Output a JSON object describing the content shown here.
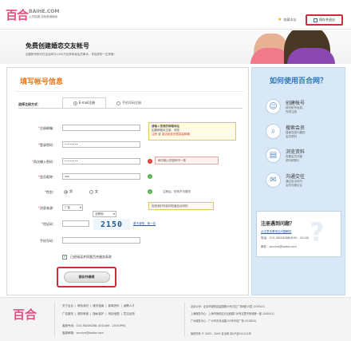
{
  "header": {
    "logo_text": "百合",
    "logo_domain": "BAIHE.COM",
    "logo_slogan": "心灵相通 成就美满姻缘",
    "favorite_label": "收藏本站",
    "save_exit_label": "保存并退出"
  },
  "banner": {
    "title": "免费创建婚恋交友帐号",
    "subtitle": "创建帐号即可在百合网与1500万优秀单身会员牵手，寻找您的一生挚爱!"
  },
  "form": {
    "title": "填写帐号信息",
    "method_label": "选择注册方式：",
    "tabs": [
      {
        "label": "E-mail注册",
        "selected": true
      },
      {
        "label": "手机号码注册",
        "selected": false
      }
    ],
    "fields": {
      "email_label": "注册邮箱：",
      "email_value": "",
      "email_tip_line1": "请输入常用的邮箱地址",
      "email_tip_line2": "如果邮箱未注册，请您",
      "email_tip_link1": "注册",
      "email_tip_or": "或",
      "email_tip_link2": "激活免费无限容量邮箱",
      "password_label": "登录密码：",
      "password_value": "••••••••",
      "confirm_label": "再次输入密码：",
      "confirm_value": "••••••••",
      "confirm_error": "两次输入的密码不一致",
      "nickname_label": "会员昵称：",
      "nickname_value": "san",
      "gender_label": "性别：",
      "gender_male": "男",
      "gender_female": "女",
      "gender_hint": "注册后，性别不可更改",
      "source_label": "消息来源：",
      "source_select1": "广告",
      "source_select2": "互联网",
      "source_hint": "告知我们你如何知道百合网的",
      "captcha_label": "验证码：",
      "captcha_image": "2150",
      "captcha_refresh": "看不清楚，换一张",
      "mobile_label": "手机号码：",
      "mobile_value": ""
    },
    "agree_text": "已经阅读并同意百合服务条款",
    "submit_label": "保存并继续"
  },
  "sidebar": {
    "title": "如何使用百合网？",
    "items": [
      {
        "title": "创建帐号",
        "desc1": "填写帐号信息，",
        "desc2": "完成注册"
      },
      {
        "title": "搜索会员",
        "desc1": "搜索您感兴趣的",
        "desc2": "会员资料"
      },
      {
        "title": "浏览资料",
        "desc1": "查看会员详细",
        "desc2": "资料和照片"
      },
      {
        "title": "沟通交往",
        "desc1": "通过百合网与",
        "desc2": "会员沟通交往"
      }
    ],
    "help": {
      "title": "注册遇到问题？",
      "link": "点这里查看常见问题解答",
      "phone": "电话：010-58206288(8:00 - 20:00)",
      "email": "邮件：service@baihe.com"
    }
  },
  "footer": {
    "logo": "百合",
    "links_row1": [
      "关于百合",
      "联系我们",
      "服务指南",
      "新闻资讯",
      "诚聘人才"
    ],
    "links_row2": [
      "广告服务",
      "服务条款",
      "隐私保护",
      "网站地图",
      "意见反馈"
    ],
    "phone": "客服专线：010-58206288 (8:00AM - 20:00PM)",
    "email": "客服邮箱：service@baihe.com",
    "addr1": "北京公司：北京市朝阳区建国路93号万达广场B座10层 (100022)",
    "addr2": "上海服务中心：上海市静安区天目西路218号嘉里不夜城第一座 (200041)",
    "addr3": "广州服务中心：广州市天河北路233号中信广场 (510620)",
    "copyright": "版权所有 © 2005 - 2009 百合网 京ICP证041124号"
  }
}
